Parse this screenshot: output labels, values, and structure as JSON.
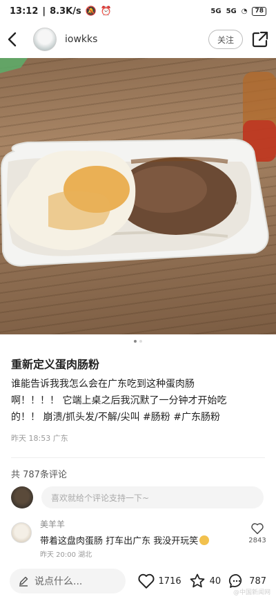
{
  "status_bar": {
    "time": "13:12",
    "speed": "8.3K/s",
    "signal1": "5G",
    "signal2": "5G",
    "battery": "78"
  },
  "header": {
    "username": "iowkks",
    "follow_label": "关注"
  },
  "carousel": {
    "current": 1,
    "total": 2
  },
  "post": {
    "title": "重新定义蛋肉肠粉",
    "body_lines": [
      "谁能告诉我我怎么会在广东吃到这种蛋肉肠",
      "啊！！！！ 它端上桌之后我沉默了一分钟才开始吃",
      "的！！ 崩溃/抓头发/不解/尖叫 #肠粉 #广东肠粉"
    ],
    "meta": "昨天 18:53 广东"
  },
  "comments": {
    "count_label": "共 787条评论",
    "input_placeholder": "喜欢就给个评论支持一下~",
    "items": [
      {
        "name": "美羊羊",
        "text": "带着这盘肉蛋肠 打车出广东 我没开玩笑",
        "meta": "昨天 20:00 湖北",
        "likes": "2843"
      }
    ]
  },
  "bottom_bar": {
    "say_placeholder": "说点什么...",
    "likes": "1716",
    "stars": "40",
    "comments": "787"
  },
  "watermark": "@中国新闻网",
  "colors": {
    "plate": "#f2f2f0",
    "egg_yolk": "#e7a43c",
    "meat": "#6b4a34",
    "table": "#9b7a5b"
  }
}
